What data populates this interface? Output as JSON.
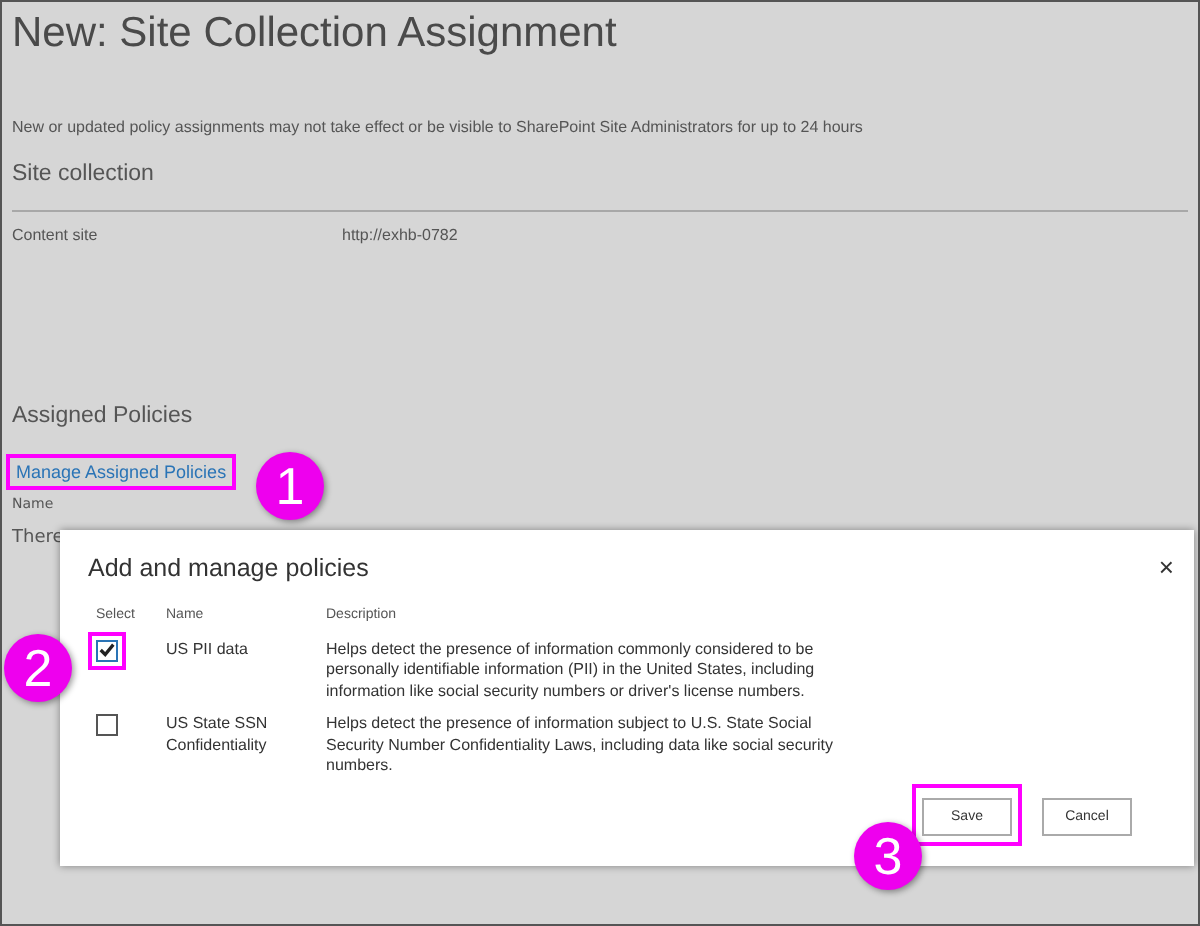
{
  "page": {
    "title": "New: Site Collection Assignment",
    "notice": "New or updated policy assignments may not take effect or be visible to SharePoint Site Administrators for up to 24 hours",
    "section": "Site collection",
    "field_label": "Content site",
    "field_value": "http://exhb-0782",
    "assigned_heading": "Assigned Policies",
    "manage_link": {
      "label": "Manage Assigned Policies",
      "highlighted": true
    },
    "table_header": "Name",
    "empty_text": "There"
  },
  "dialog": {
    "title": "Add and manage policies",
    "close": "×",
    "columns": [
      "Select",
      "Name",
      "Description"
    ],
    "rows": [
      {
        "checked": true,
        "highlighted": true,
        "name": "US PII data",
        "description": "Helps detect the presence of information commonly considered to be personally identifiable information (PII) in the United States, including information like social security numbers or driver's license numbers."
      },
      {
        "checked": false,
        "highlighted": false,
        "name": "US State SSN Confidentiality",
        "description": "Helps detect the presence of information subject to U.S. State Social Security Number Confidentiality Laws, including data like social security numbers."
      }
    ],
    "buttons": [
      {
        "label": "Save",
        "highlighted": true
      },
      {
        "label": "Cancel",
        "highlighted": false
      }
    ]
  },
  "callouts": [
    "1",
    "2",
    "3"
  ]
}
